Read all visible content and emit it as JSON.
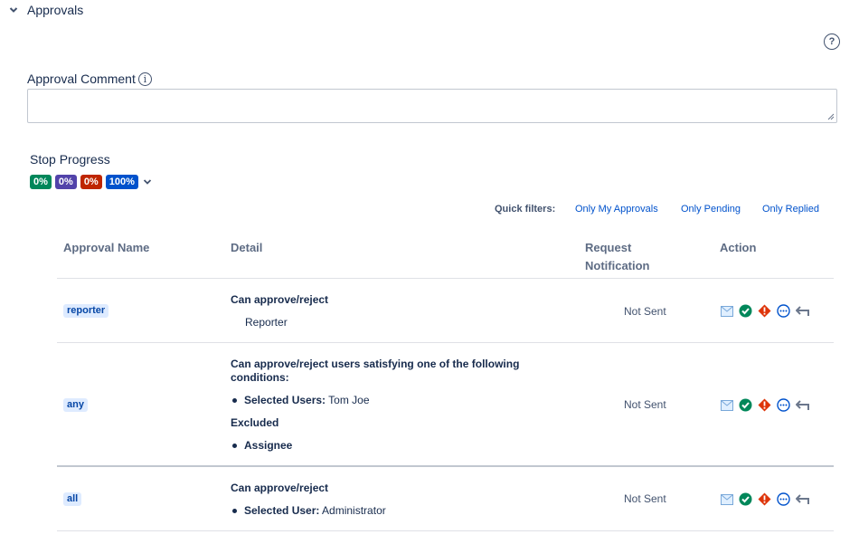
{
  "section": {
    "title": "Approvals"
  },
  "help": {
    "glyph": "?"
  },
  "comment": {
    "label": "Approval Comment",
    "info_glyph": "i",
    "value": ""
  },
  "stop": {
    "label": "Stop Progress",
    "pills": [
      {
        "text": "0%",
        "color": "#00875a"
      },
      {
        "text": "0%",
        "color": "#5243aa"
      },
      {
        "text": "0%",
        "color": "#bf2600"
      },
      {
        "text": "100%",
        "color": "#0052cc"
      }
    ]
  },
  "filters": {
    "label": "Quick filters:",
    "links": [
      "Only My Approvals",
      "Only Pending",
      "Only Replied"
    ]
  },
  "table": {
    "headers": {
      "name": "Approval Name",
      "detail": "Detail",
      "notification_line1": "Request",
      "notification_line2": "Notification",
      "action": "Action"
    },
    "rows": [
      {
        "name": "reporter",
        "title": "Can approve/reject",
        "value": "Reporter",
        "status": "Not Sent"
      },
      {
        "name": "any",
        "title_line1": "Can approve/reject users satisfying one of the following",
        "title_line2": "conditions:",
        "selected_label": "Selected Users:",
        "selected_value": "Tom Joe",
        "excluded_label": "Excluded",
        "excluded_item": "Assignee",
        "status": "Not Sent"
      },
      {
        "name": "all",
        "title": "Can approve/reject",
        "selected_label": "Selected User:",
        "selected_value": "Administrator",
        "status": "Not Sent"
      }
    ]
  },
  "action_icons": [
    "mail-icon",
    "approve-check-icon",
    "reject-alert-icon",
    "more-options-icon",
    "reply-arrow-icon"
  ],
  "colors": {
    "approve": "#00875a",
    "reject": "#de350b",
    "more": "#0052cc",
    "mail": "#79a8d9",
    "reply": "#6b778c"
  }
}
